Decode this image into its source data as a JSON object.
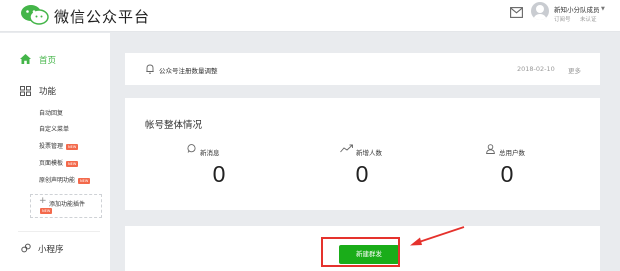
{
  "header": {
    "logo_text": "微信公众平台",
    "account_name": "新知小分队成员",
    "account_type": "订阅号",
    "account_status": "未认证"
  },
  "sidebar": {
    "home": "首页",
    "function": "功能",
    "items": [
      {
        "label": "自动回复",
        "badge": ""
      },
      {
        "label": "自定义菜单",
        "badge": ""
      },
      {
        "label": "投票管理",
        "badge": "NEW"
      },
      {
        "label": "页面模板",
        "badge": "NEW"
      },
      {
        "label": "原创声明功能",
        "badge": "NEW"
      }
    ],
    "add_plugin": "添加功能插件",
    "add_plugin_badge": "NEW",
    "mini_program": "小程序"
  },
  "notice": {
    "text": "公众号注册数量调整",
    "date": "2018-02-10",
    "more": "更多"
  },
  "overview": {
    "title": "帐号整体情况",
    "stats": [
      {
        "label": "新消息",
        "value": "0",
        "icon": "chat-bubble-icon"
      },
      {
        "label": "新增人数",
        "value": "0",
        "icon": "trend-up-icon"
      },
      {
        "label": "总用户数",
        "value": "0",
        "icon": "user-icon"
      }
    ]
  },
  "mass": {
    "button_label": "新建群发"
  },
  "colors": {
    "accent_green": "#44b549",
    "button_green": "#1aad19",
    "annotation_red": "#e5322d",
    "badge_red": "#f3694b"
  }
}
